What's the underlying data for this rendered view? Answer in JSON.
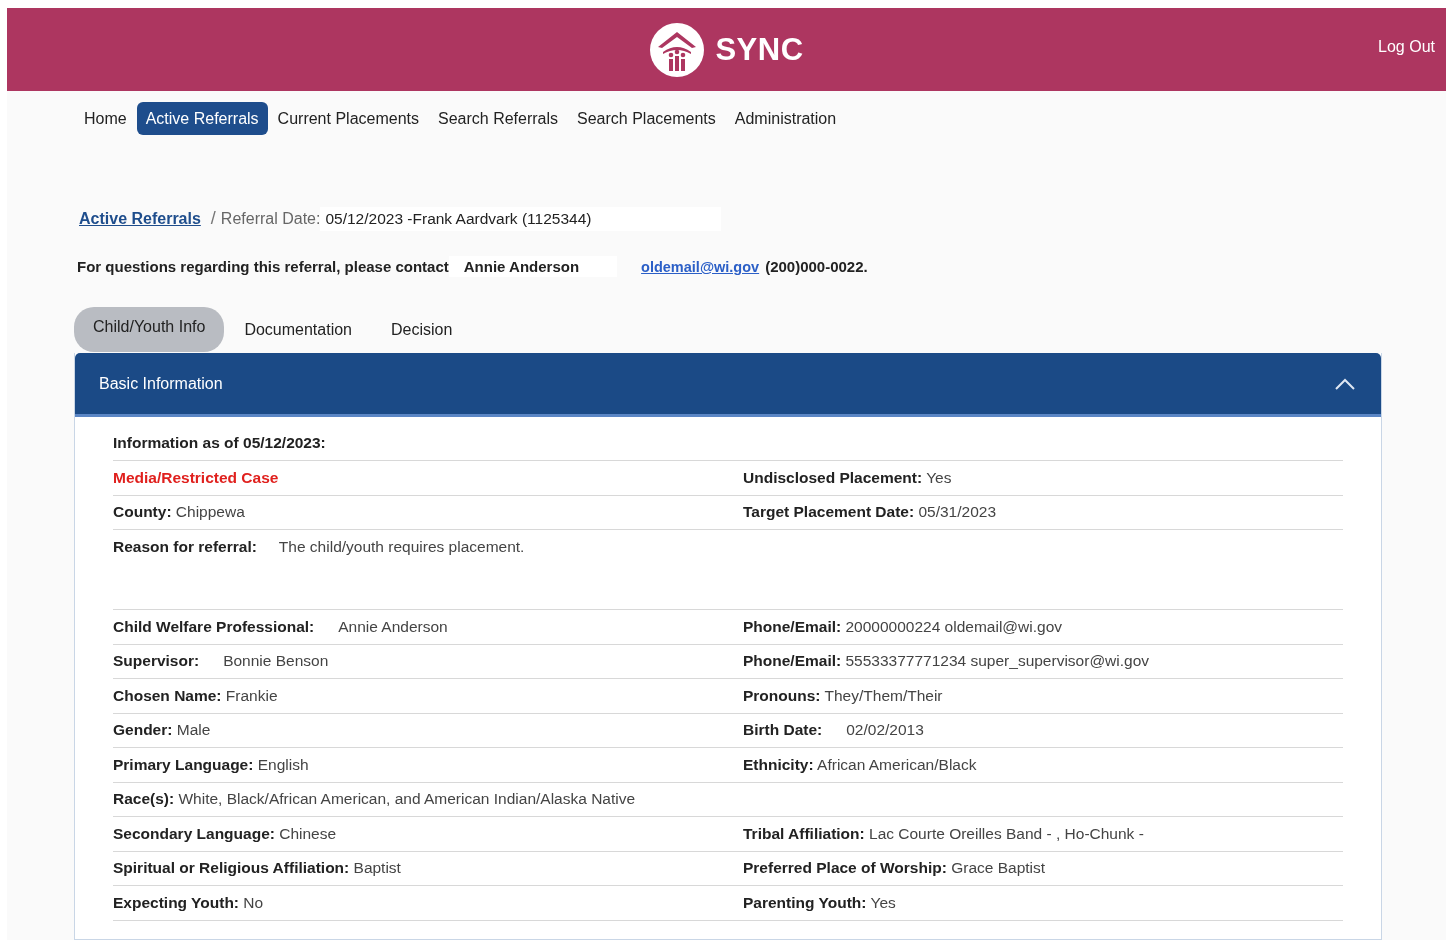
{
  "header": {
    "brand": "SYNC",
    "logout": "Log Out"
  },
  "nav": [
    {
      "label": "Home",
      "selected": false
    },
    {
      "label": "Active Referrals",
      "selected": true
    },
    {
      "label": "Current Placements",
      "selected": false
    },
    {
      "label": "Search Referrals",
      "selected": false
    },
    {
      "label": "Search Placements",
      "selected": false
    },
    {
      "label": "Administration",
      "selected": false
    }
  ],
  "breadcrumb": {
    "link": "Active Referrals",
    "separator": "/",
    "label": "Referral Date:",
    "value": "05/12/2023 -Frank Aardvark (1125344)"
  },
  "contact": {
    "text": "For questions regarding this referral, please contact",
    "name": "Annie Anderson",
    "email": "oldemail@wi.gov",
    "phone": "(200)000-0022."
  },
  "tabs": [
    {
      "label": "Child/Youth Info",
      "selected": true
    },
    {
      "label": "Documentation",
      "selected": false
    },
    {
      "label": "Decision",
      "selected": false
    }
  ],
  "panel": {
    "title": "Basic Information",
    "expanded": true,
    "heading": "Information as of 05/12/2023:",
    "rows": [
      {
        "kind": "pair",
        "cells": [
          {
            "kind": "alert",
            "label": "Media/Restricted Case"
          },
          {
            "kind": "field",
            "label": "Undisclosed Placement:",
            "value": "Yes"
          }
        ]
      },
      {
        "kind": "pair",
        "cells": [
          {
            "kind": "field",
            "label": "County:",
            "value": "Chippewa"
          },
          {
            "kind": "field",
            "label": "Target Placement Date:",
            "value": "05/31/2023"
          }
        ]
      },
      {
        "kind": "tall",
        "cells": [
          {
            "kind": "spaced",
            "label": "Reason for referral:",
            "value": "The child/youth requires placement."
          }
        ]
      },
      {
        "kind": "pair",
        "cells": [
          {
            "kind": "spaced",
            "label": "Child Welfare Professional:",
            "value": "Annie Anderson"
          },
          {
            "kind": "field",
            "label": "Phone/Email:",
            "value": "20000000224  oldemail@wi.gov"
          }
        ]
      },
      {
        "kind": "pair",
        "cells": [
          {
            "kind": "spaced",
            "label": "Supervisor:",
            "value": "Bonnie Benson"
          },
          {
            "kind": "field",
            "label": "Phone/Email:",
            "value": "55533377771234  super_supervisor@wi.gov"
          }
        ]
      },
      {
        "kind": "pair",
        "cells": [
          {
            "kind": "field",
            "label": "Chosen Name:",
            "value": "Frankie"
          },
          {
            "kind": "field",
            "label": "Pronouns:",
            "value": "They/Them/Their"
          }
        ]
      },
      {
        "kind": "pair",
        "cells": [
          {
            "kind": "field",
            "label": "Gender:",
            "value": "Male"
          },
          {
            "kind": "spaced",
            "label": "Birth Date:",
            "value": "02/02/2013"
          }
        ]
      },
      {
        "kind": "pair",
        "cells": [
          {
            "kind": "field",
            "label": "Primary Language:",
            "value": "English"
          },
          {
            "kind": "field",
            "label": "Ethnicity:",
            "value": "African American/Black"
          }
        ]
      },
      {
        "kind": "pair",
        "cells": [
          {
            "kind": "field",
            "label": "Race(s):",
            "value": "White, Black/African American, and American Indian/Alaska Native"
          }
        ]
      },
      {
        "kind": "pair",
        "cells": [
          {
            "kind": "field",
            "label": "Secondary Language:",
            "value": "Chinese"
          },
          {
            "kind": "field",
            "label": "Tribal Affiliation:",
            "value": "Lac Courte Oreilles Band - , Ho-Chunk -"
          }
        ]
      },
      {
        "kind": "pair",
        "cells": [
          {
            "kind": "field",
            "label": "Spiritual or Religious Affiliation:",
            "value": "Baptist"
          },
          {
            "kind": "field",
            "label": "Preferred Place of Worship:",
            "value": "Grace Baptist"
          }
        ]
      },
      {
        "kind": "pair",
        "cells": [
          {
            "kind": "field",
            "label": "Expecting Youth:",
            "value": "No"
          },
          {
            "kind": "field",
            "label": "Parenting Youth:",
            "value": "Yes"
          }
        ]
      }
    ]
  }
}
